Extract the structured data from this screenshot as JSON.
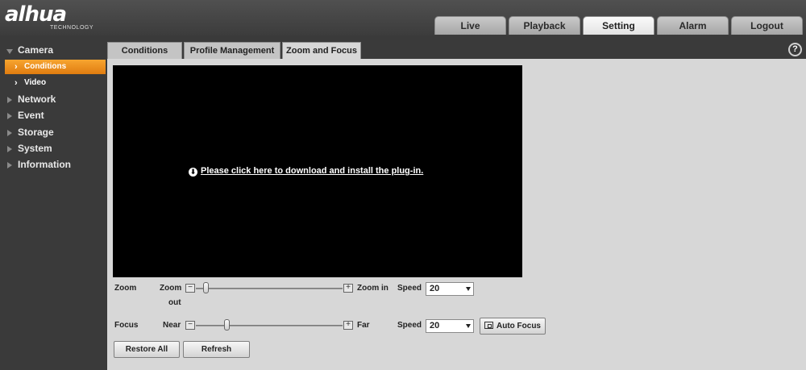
{
  "brand": {
    "logo": "alhua",
    "sub": "TECHNOLOGY"
  },
  "nav": [
    "Live",
    "Playback",
    "Setting",
    "Alarm",
    "Logout"
  ],
  "nav_active": "Setting",
  "sidebar": {
    "camera": "Camera",
    "conditions": "Conditions",
    "video": "Video",
    "network": "Network",
    "event": "Event",
    "storage": "Storage",
    "system": "System",
    "information": "Information"
  },
  "subtabs": [
    "Conditions",
    "Profile Management",
    "Zoom and Focus"
  ],
  "help": "?",
  "video": {
    "plugin_text": "Please click here to download and install the plug-in."
  },
  "zoom": {
    "label": "Zoom",
    "out": "Zoom",
    "out2": "out",
    "in": "Zoom in",
    "speed_label": "Speed",
    "speed_value": "20",
    "level": 0.05
  },
  "focus": {
    "label": "Focus",
    "near": "Near",
    "far": "Far",
    "speed_label": "Speed",
    "speed_value": "20",
    "level": 0.2
  },
  "buttons": {
    "auto_focus": "Auto Focus",
    "restore_all": "Restore All",
    "refresh": "Refresh",
    "minus": "−",
    "plus": "+"
  }
}
